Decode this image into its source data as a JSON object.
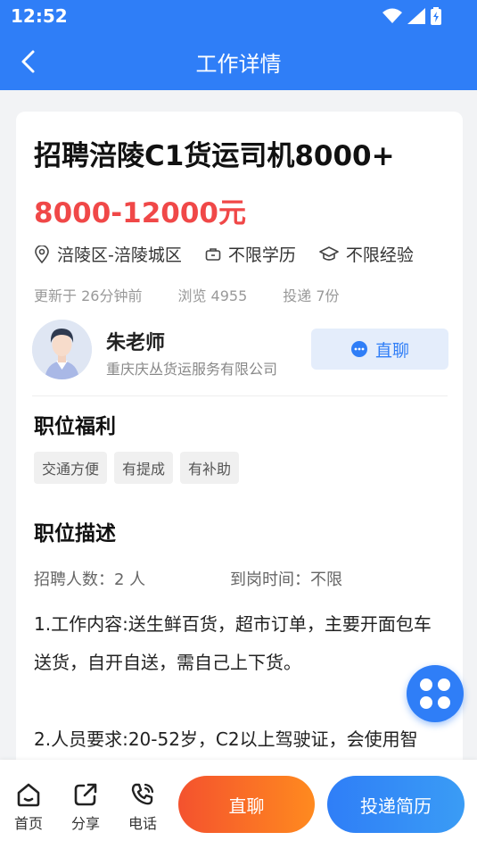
{
  "status_bar": {
    "time": "12:52"
  },
  "header": {
    "title": "工作详情"
  },
  "job": {
    "title": "招聘涪陵C1货运司机8000+",
    "salary": "8000-12000元",
    "location": "涪陵区-涪陵城区",
    "education": "不限学历",
    "experience": "不限经验",
    "updated": "更新于 26分钟前",
    "views": "浏览 4955",
    "applications": "投递 7份"
  },
  "recruiter": {
    "name": "朱老师",
    "company": "重庆庆丛货运服务有限公司",
    "chat_label": "直聊"
  },
  "welfare": {
    "title": "职位福利",
    "tags": [
      "交通方便",
      "有提成",
      "有补助"
    ]
  },
  "description": {
    "title": "职位描述",
    "headcount": "招聘人数：2 人",
    "arrival": "到岗时间：不限",
    "text": "1.工作内容:送生鲜百货，超市订单，主要开面包车送货，自开自送，需自己上下货。\n\n2.人员要求:20-52岁，C2以上驾驶证，会使用智"
  },
  "bottom_bar": {
    "home": "首页",
    "share": "分享",
    "phone": "电话",
    "chat": "直聊",
    "apply": "投递简历"
  },
  "colors": {
    "primary": "#2f7ef7",
    "salary": "#f04848",
    "chat_gradient_start": "#f4522e",
    "chat_gradient_end": "#ff8a1f"
  },
  "icons": [
    "back-icon",
    "wifi-icon",
    "signal-icon",
    "battery-icon",
    "location-icon",
    "briefcase-icon",
    "graduation-cap-icon",
    "chat-bubble-icon",
    "home-icon",
    "share-icon",
    "phone-icon",
    "grid-menu-icon"
  ]
}
